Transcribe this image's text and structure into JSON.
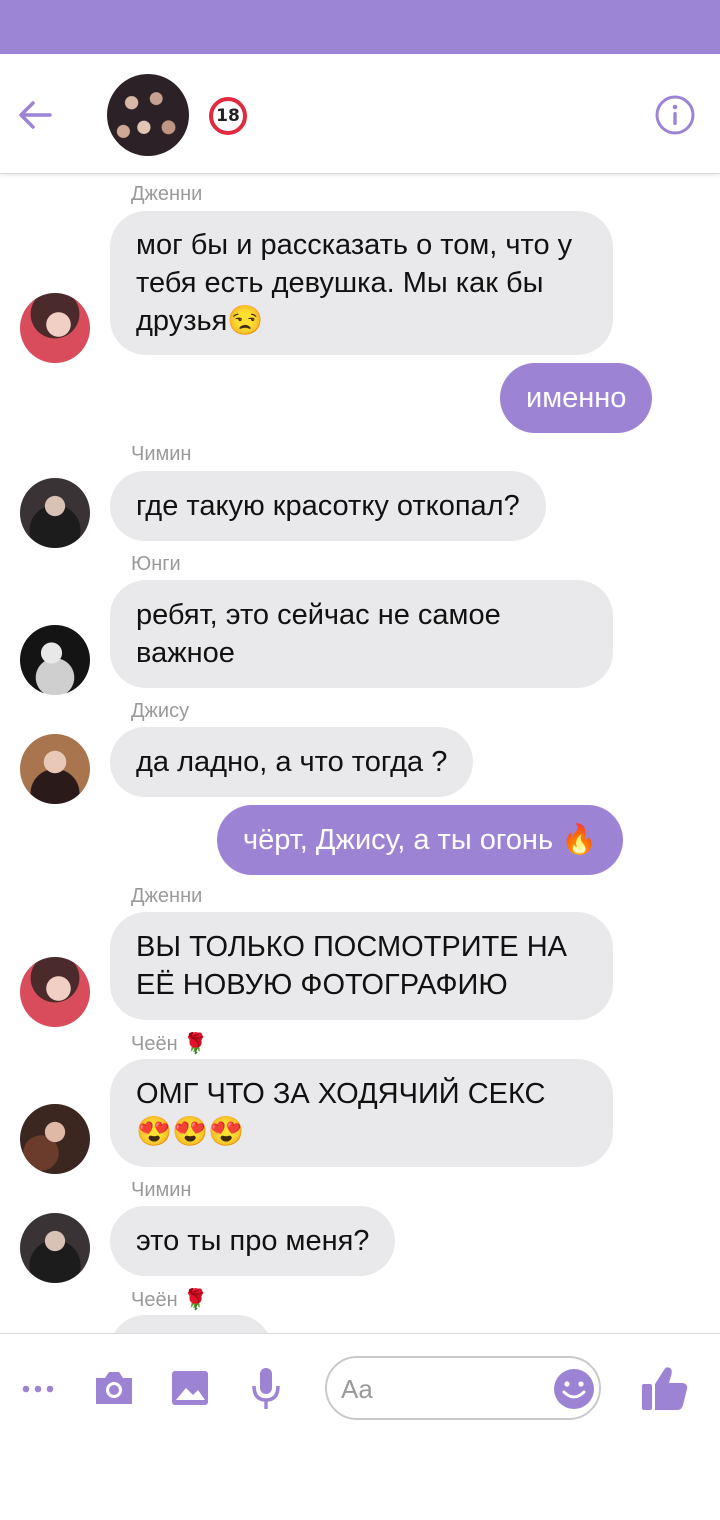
{
  "header": {
    "badge": "18",
    "accent_color": "#9d83d3"
  },
  "messages": [
    {
      "sender": "Дженни",
      "text": "мог бы и рассказать о том, что у тебя есть девушка. Мы как бы друзья😒",
      "direction": "in"
    },
    {
      "text": "именно",
      "direction": "out"
    },
    {
      "sender": "Чимин",
      "text": "где такую красотку откопал?",
      "direction": "in"
    },
    {
      "sender": "Юнги",
      "text": "ребят, это сейчас не самое важное",
      "direction": "in"
    },
    {
      "sender": "Джису",
      "text": "да ладно, а что тогда ?",
      "direction": "in"
    },
    {
      "text": "чёрт, Джису, а ты огонь 🔥",
      "direction": "out"
    },
    {
      "sender": "Дженни",
      "text": "ВЫ ТОЛЬКО ПОСМОТРИТЕ НА ЕЁ НОВУЮ ФОТОГРАФИЮ",
      "direction": "in"
    },
    {
      "sender": "Чеён 🌹",
      "text": "ОМГ ЧТО ЗА ХОДЯЧИЙ СЕКС 😍😍😍",
      "direction": "in"
    },
    {
      "sender": "Чимин",
      "text": "это ты про меня?",
      "direction": "in"
    },
    {
      "sender": "Чеён 🌹",
      "text": "",
      "direction": "in"
    }
  ],
  "composer": {
    "placeholder": "Aa",
    "icons": [
      "more-icon",
      "camera-icon",
      "image-icon",
      "microphone-icon",
      "emoji-icon",
      "thumbs-up-icon"
    ]
  }
}
